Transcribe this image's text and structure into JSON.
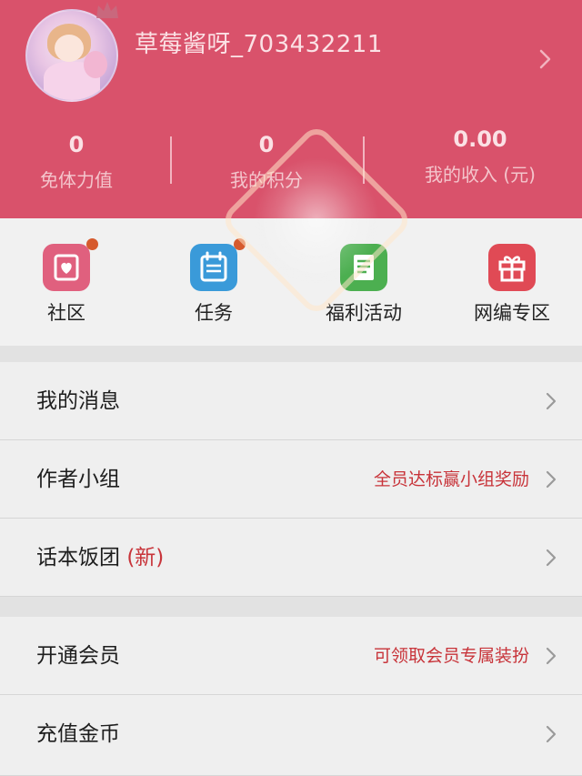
{
  "profile": {
    "username": "草莓酱呀_703432211",
    "avatar_icon": "avatar-image",
    "badge_icon": "crown-icon"
  },
  "stats": [
    {
      "value": "0",
      "label": "免体力值"
    },
    {
      "value": "0",
      "label": "我的积分"
    },
    {
      "value": "0.00",
      "label": "我的收入 (元)"
    }
  ],
  "actions": [
    {
      "label": "社区",
      "icon": "community-icon",
      "color": "#e0607e",
      "badge": true
    },
    {
      "label": "任务",
      "icon": "task-icon",
      "color": "#3a9ad9",
      "badge": true
    },
    {
      "label": "福利活动",
      "icon": "benefit-icon",
      "color": "#4caf50",
      "badge": false
    },
    {
      "label": "网编专区",
      "icon": "gift-icon",
      "color": "#e04a55",
      "badge": false
    }
  ],
  "menu": [
    {
      "label": "我的消息",
      "suffix": "",
      "note": ""
    },
    {
      "label": "作者小组",
      "suffix": "",
      "note": "全员达标赢小组奖励"
    },
    {
      "label": "话本饭团",
      "suffix": "(新)",
      "note": ""
    },
    {
      "label": "开通会员",
      "suffix": "",
      "note": "可领取会员专属装扮"
    },
    {
      "label": "充值金币",
      "suffix": "",
      "note": ""
    }
  ],
  "colors": {
    "header_bg": "#d9526b",
    "accent_red": "#c8343a",
    "badge_dot": "#d65a2d"
  }
}
